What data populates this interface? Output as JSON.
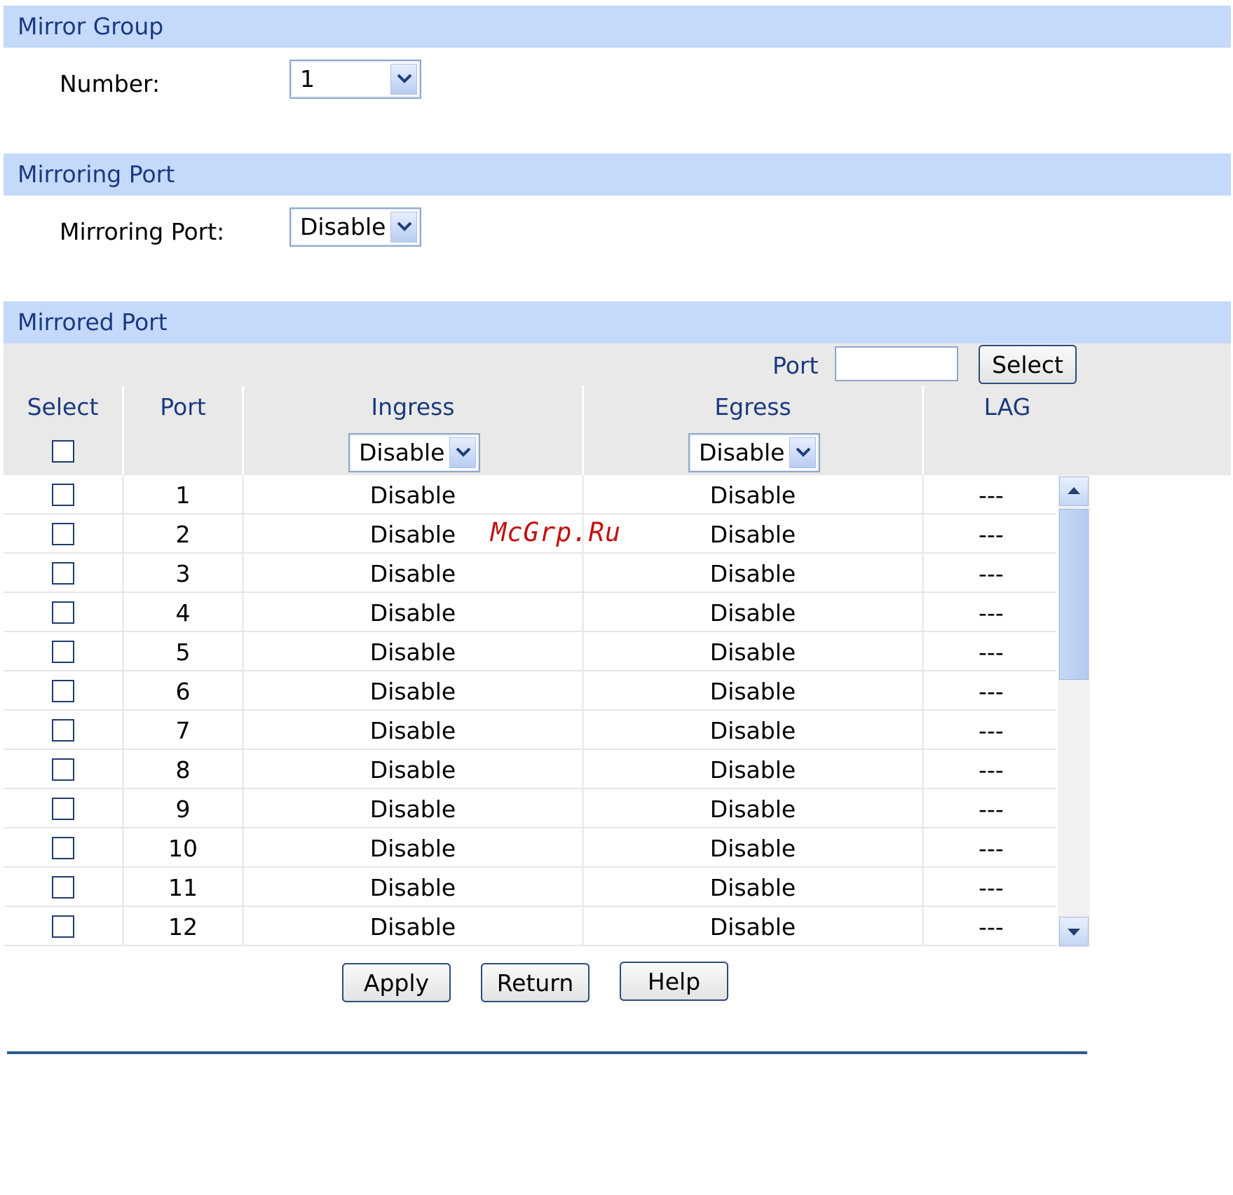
{
  "mirror_group": {
    "title": "Mirror Group",
    "number_label": "Number:",
    "number_value": "1"
  },
  "mirroring_port": {
    "title": "Mirroring Port",
    "label": "Mirroring Port:",
    "value": "Disable"
  },
  "mirrored_port": {
    "title": "Mirrored Port",
    "port_search_label": "Port",
    "port_search_value": "",
    "select_button": "Select",
    "columns": [
      "Select",
      "Port",
      "Ingress",
      "Egress",
      "LAG"
    ],
    "ingress_all": "Disable",
    "egress_all": "Disable",
    "rows": [
      {
        "port": "1",
        "ingress": "Disable",
        "egress": "Disable",
        "lag": "---"
      },
      {
        "port": "2",
        "ingress": "Disable",
        "egress": "Disable",
        "lag": "---"
      },
      {
        "port": "3",
        "ingress": "Disable",
        "egress": "Disable",
        "lag": "---"
      },
      {
        "port": "4",
        "ingress": "Disable",
        "egress": "Disable",
        "lag": "---"
      },
      {
        "port": "5",
        "ingress": "Disable",
        "egress": "Disable",
        "lag": "---"
      },
      {
        "port": "6",
        "ingress": "Disable",
        "egress": "Disable",
        "lag": "---"
      },
      {
        "port": "7",
        "ingress": "Disable",
        "egress": "Disable",
        "lag": "---"
      },
      {
        "port": "8",
        "ingress": "Disable",
        "egress": "Disable",
        "lag": "---"
      },
      {
        "port": "9",
        "ingress": "Disable",
        "egress": "Disable",
        "lag": "---"
      },
      {
        "port": "10",
        "ingress": "Disable",
        "egress": "Disable",
        "lag": "---"
      },
      {
        "port": "11",
        "ingress": "Disable",
        "egress": "Disable",
        "lag": "---"
      },
      {
        "port": "12",
        "ingress": "Disable",
        "egress": "Disable",
        "lag": "---"
      }
    ]
  },
  "buttons": {
    "apply": "Apply",
    "return": "Return",
    "help": "Help"
  },
  "watermark": "McGrp.Ru",
  "colors": {
    "section_bar": "#c5d9fb",
    "section_text": "#1b3a7e",
    "header_row": "#e9e9e9",
    "watermark": "#c21010"
  }
}
